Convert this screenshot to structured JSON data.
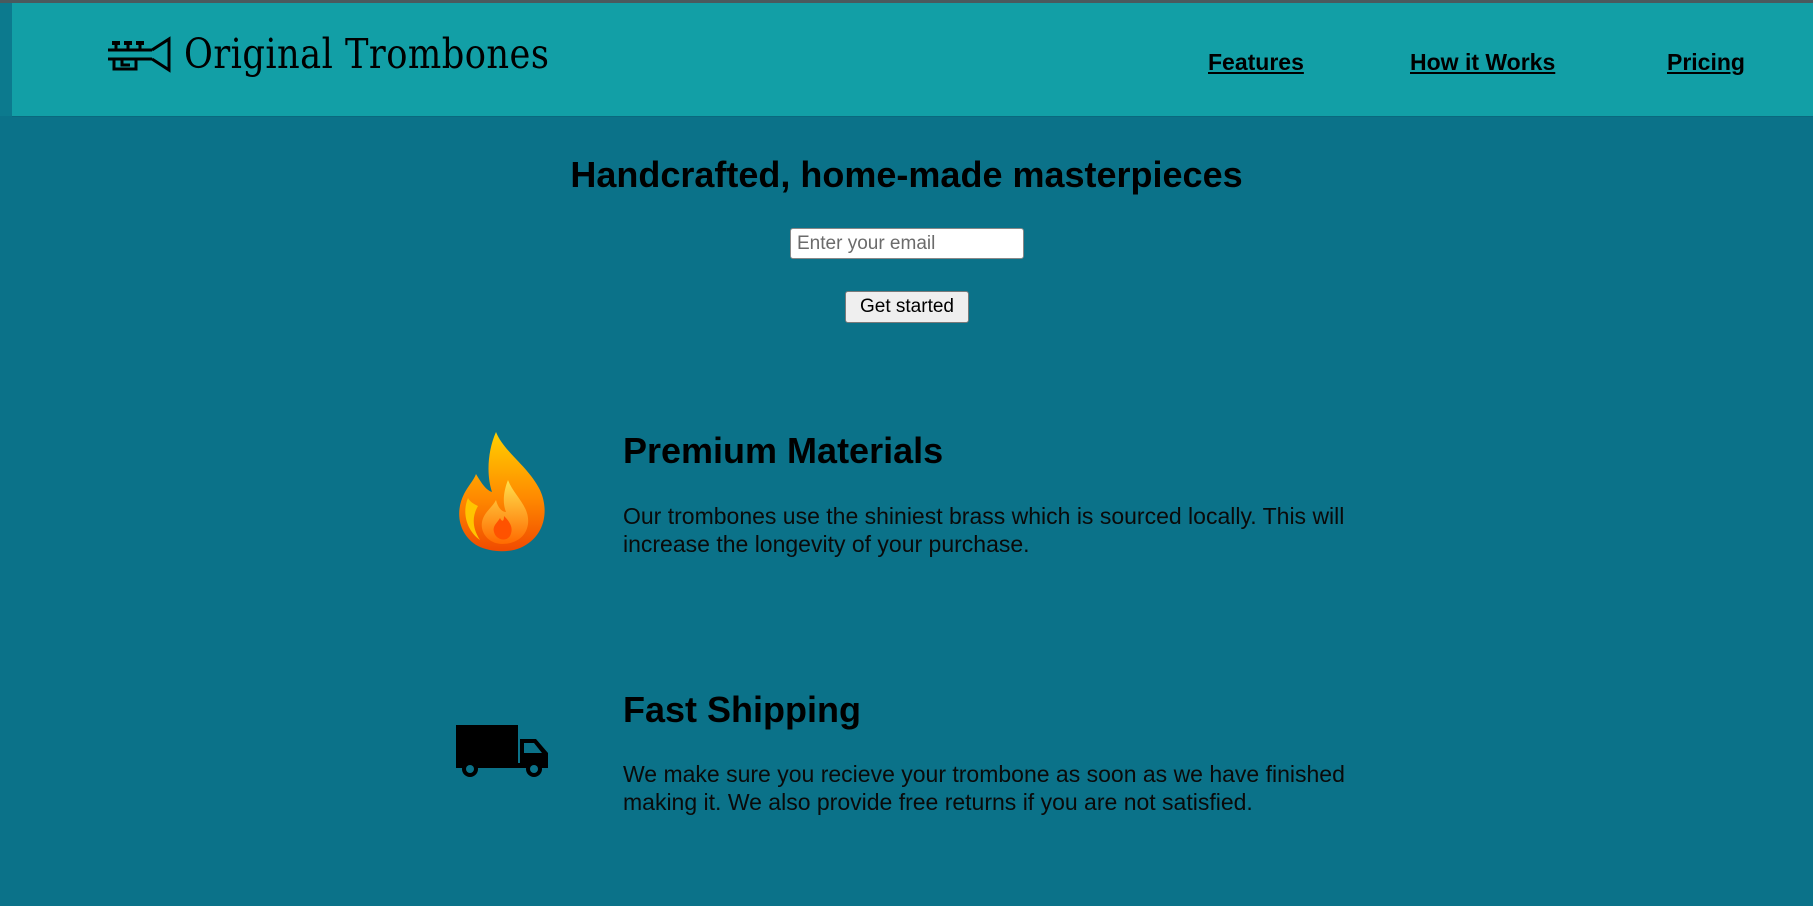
{
  "header": {
    "brand": "Original Trombones",
    "nav": [
      {
        "label": "Features"
      },
      {
        "label": "How it Works"
      },
      {
        "label": "Pricing"
      }
    ]
  },
  "hero": {
    "title": "Handcrafted, home-made masterpieces",
    "email_placeholder": "Enter your email",
    "cta_label": "Get started"
  },
  "features": [
    {
      "icon": "fire-icon",
      "title": "Premium Materials",
      "text": "Our trombones use the shiniest brass which is sourced locally. This will increase the longevity of your purchase."
    },
    {
      "icon": "truck-icon",
      "title": "Fast Shipping",
      "text": "We make sure you recieve your trombone as soon as we have finished making it. We also provide free returns if you are not satisfied."
    }
  ],
  "colors": {
    "page_background": "#0b7289",
    "header_background": "#129fa6"
  }
}
